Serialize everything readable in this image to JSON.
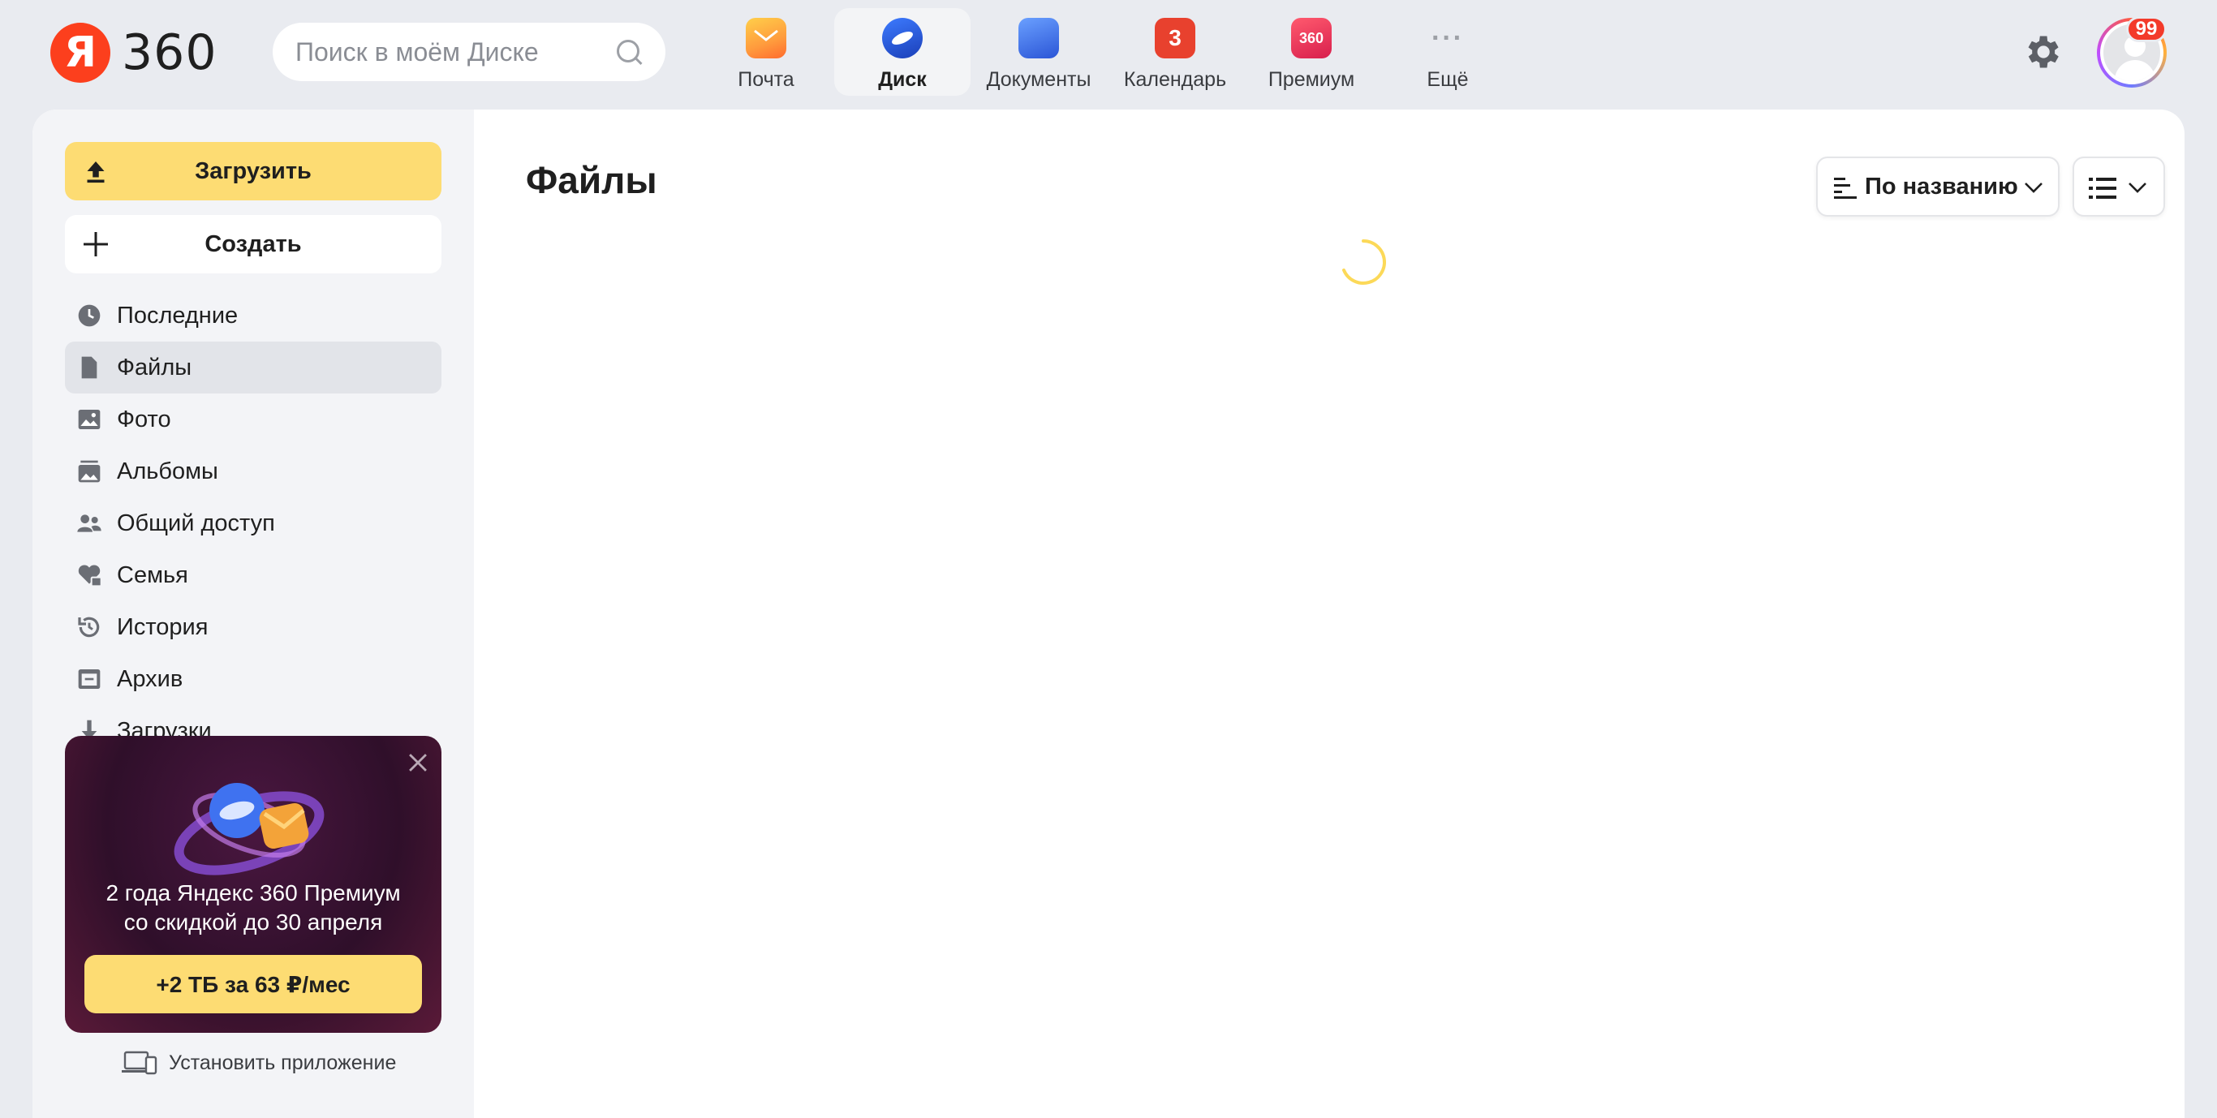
{
  "header": {
    "logo_text": "360",
    "logo_letter": "Я",
    "search_placeholder": "Поиск в моём Диске",
    "apps": [
      {
        "label": "Почта",
        "icon": "mail-icon"
      },
      {
        "label": "Диск",
        "icon": "disk-icon",
        "active": true
      },
      {
        "label": "Документы",
        "icon": "docs-icon"
      },
      {
        "label": "Календарь",
        "icon": "calendar-icon",
        "icon_text": "3"
      },
      {
        "label": "Премиум",
        "icon": "premium-icon",
        "icon_text": "360"
      },
      {
        "label": "Ещё",
        "icon": "more-icon",
        "icon_text": "···"
      }
    ],
    "notification_badge": "99"
  },
  "sidebar": {
    "upload_label": "Загрузить",
    "create_label": "Создать",
    "items": [
      {
        "label": "Последние",
        "icon": "clock-icon"
      },
      {
        "label": "Файлы",
        "icon": "file-icon",
        "active": true
      },
      {
        "label": "Фото",
        "icon": "photo-icon"
      },
      {
        "label": "Альбомы",
        "icon": "albums-icon"
      },
      {
        "label": "Общий доступ",
        "icon": "shared-icon"
      },
      {
        "label": "Семья",
        "icon": "family-icon"
      },
      {
        "label": "История",
        "icon": "history-icon"
      },
      {
        "label": "Архив",
        "icon": "archive-icon"
      },
      {
        "label": "Загрузки",
        "icon": "download-icon"
      }
    ],
    "promo": {
      "line1": "2 года Яндекс 360 Премиум",
      "line2": "со скидкой до 30 апреля",
      "button": "+2 ТБ за 63 ₽/мес"
    },
    "install_label": "Установить приложение"
  },
  "main": {
    "title": "Файлы",
    "sort_label": "По названию"
  },
  "colors": {
    "accent": "#fddc73",
    "background": "#e9ebf0",
    "sidebar": "#f3f4f7"
  }
}
